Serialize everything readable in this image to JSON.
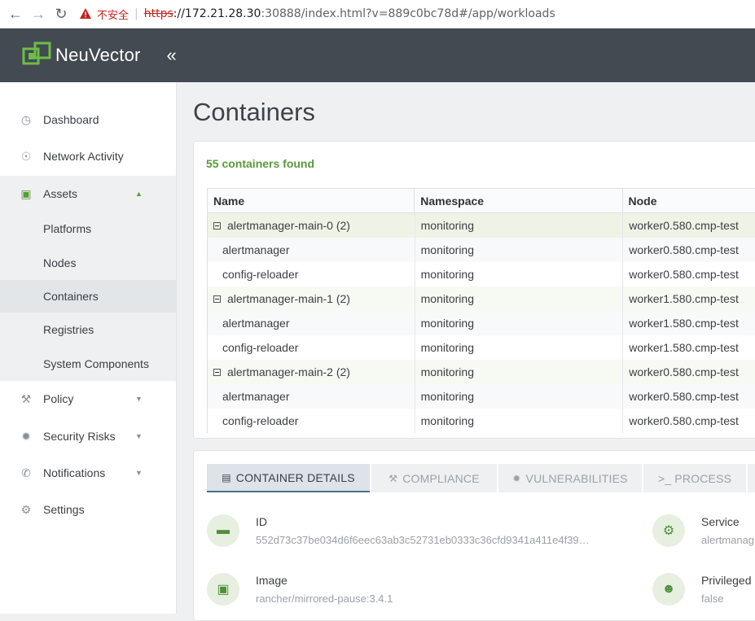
{
  "browser": {
    "insecure_label": "不安全",
    "separator": "|",
    "url_proto": "https",
    "url_host": "://172.21.28.30",
    "url_rest": ":30888/index.html?v=889c0bc78d#/app/workloads"
  },
  "app": {
    "name": "NeuVector",
    "collapse_glyph": "«",
    "accent": "#5a9a3b",
    "header_bg": "#434a52"
  },
  "sidebar": {
    "items": [
      {
        "label": "Dashboard",
        "icon": "dashboard-icon"
      },
      {
        "label": "Network Activity",
        "icon": "globe-icon"
      },
      {
        "label": "Assets",
        "icon": "cubes-icon",
        "expanded": true
      },
      {
        "label": "Policy",
        "icon": "gavel-icon"
      },
      {
        "label": "Security Risks",
        "icon": "bug-icon"
      },
      {
        "label": "Notifications",
        "icon": "phone-icon"
      },
      {
        "label": "Settings",
        "icon": "wrench-icon"
      }
    ],
    "asset_children": [
      "Platforms",
      "Nodes",
      "Containers",
      "Registries",
      "System Components"
    ],
    "active_child": "Containers"
  },
  "page": {
    "title": "Containers",
    "found_text": "55 containers found"
  },
  "table": {
    "columns": [
      "Name",
      "Namespace",
      "Node"
    ],
    "rows": [
      {
        "name": "alertmanager-main-0 (2)",
        "namespace": "monitoring",
        "node": "worker0.580.cmp-test"
      },
      {
        "name": "alertmanager",
        "namespace": "monitoring",
        "node": "worker0.580.cmp-test"
      },
      {
        "name": "config-reloader",
        "namespace": "monitoring",
        "node": "worker0.580.cmp-test"
      },
      {
        "name": "alertmanager-main-1 (2)",
        "namespace": "monitoring",
        "node": "worker1.580.cmp-test"
      },
      {
        "name": "alertmanager",
        "namespace": "monitoring",
        "node": "worker1.580.cmp-test"
      },
      {
        "name": "config-reloader",
        "namespace": "monitoring",
        "node": "worker1.580.cmp-test"
      },
      {
        "name": "alertmanager-main-2 (2)",
        "namespace": "monitoring",
        "node": "worker0.580.cmp-test"
      },
      {
        "name": "alertmanager",
        "namespace": "monitoring",
        "node": "worker0.580.cmp-test"
      },
      {
        "name": "config-reloader",
        "namespace": "monitoring",
        "node": "worker0.580.cmp-test"
      }
    ]
  },
  "tabs": [
    "CONTAINER DETAILS",
    "COMPLIANCE",
    "VULNERABILITIES",
    ">_ PROCESS"
  ],
  "details": {
    "id_label": "ID",
    "id_value": "552d73c37be034d6f6eec63ab3c52731eb0333c36cfd9341a411e4f39…",
    "image_label": "Image",
    "image_value": "rancher/mirrored-pause:3.4.1",
    "service_label": "Service",
    "service_value": "alertmanag",
    "privileged_label": "Privileged",
    "privileged_value": "false"
  }
}
